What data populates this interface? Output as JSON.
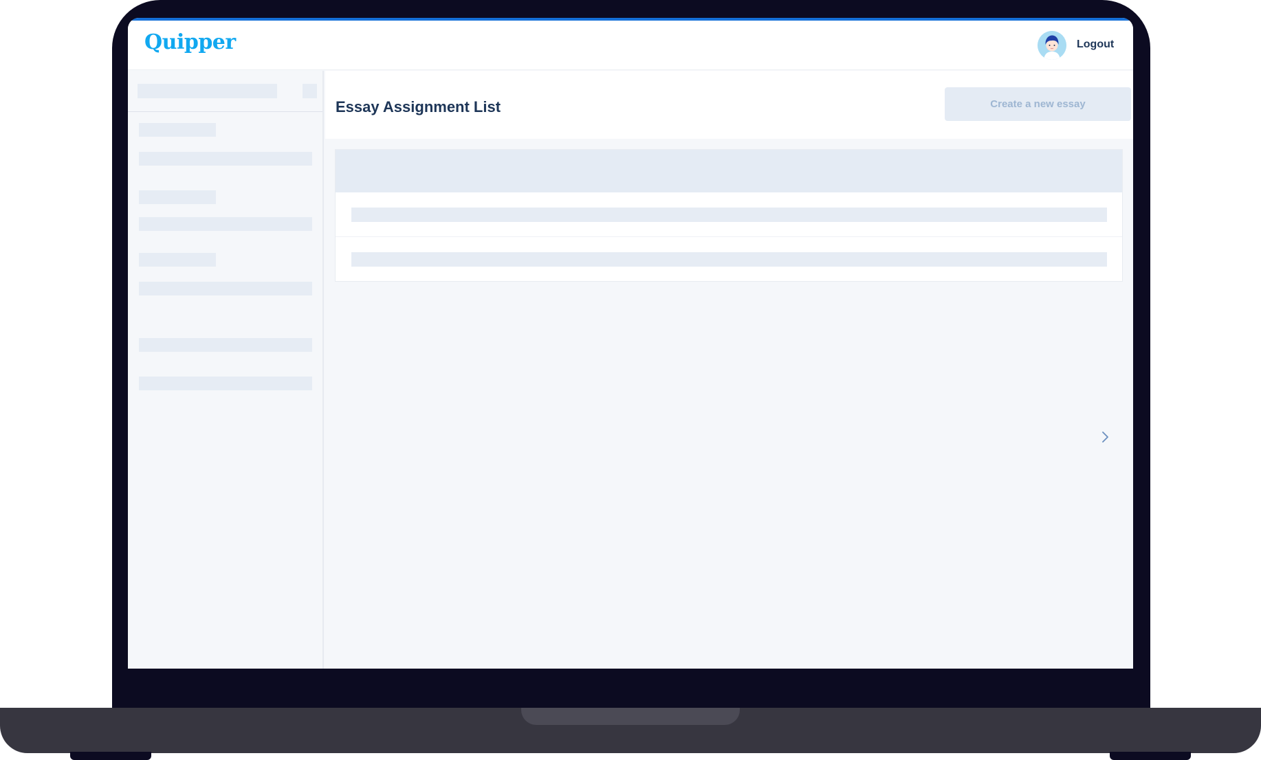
{
  "header": {
    "logo_text": "Quipper",
    "logout_label": "Logout"
  },
  "main": {
    "title": "Essay Assignment List",
    "create_button_label": "Create a new essay"
  },
  "icons": {
    "avatar": "student-avatar-icon",
    "pagination_next": "chevron-right-icon"
  },
  "colors": {
    "brand": "#11a8f0",
    "title_text": "#1d3557",
    "skeleton": "#e6ecf4",
    "button_disabled_bg": "#e4ebf4",
    "button_disabled_text": "#9eb6d2",
    "laptop_frame": "#0c0b21"
  }
}
